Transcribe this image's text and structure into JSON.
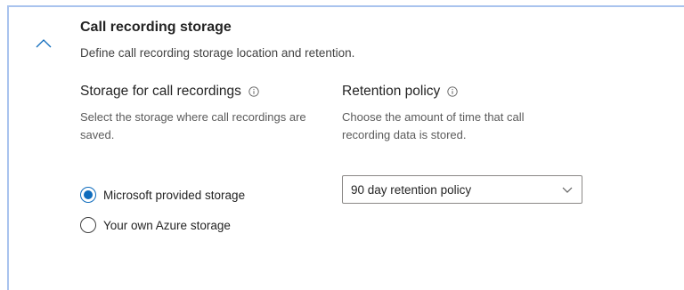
{
  "section": {
    "title": "Call recording storage",
    "description": "Define call recording storage location and retention.",
    "collapse_icon": "chevron-up-icon"
  },
  "storage": {
    "title": "Storage for call recordings",
    "info_icon": "info-icon",
    "description": "Select the storage where call recordings are saved.",
    "options": [
      {
        "label": "Microsoft provided storage",
        "selected": true
      },
      {
        "label": "Your own Azure storage",
        "selected": false
      }
    ]
  },
  "retention": {
    "title": "Retention policy",
    "info_icon": "info-icon",
    "description": "Choose the amount of time that call recording data is stored.",
    "selected_value": "90 day retention policy",
    "dropdown_icon": "chevron-down-icon"
  },
  "colors": {
    "accent": "#0f6cbd",
    "frame_border": "#a9c3ee"
  }
}
